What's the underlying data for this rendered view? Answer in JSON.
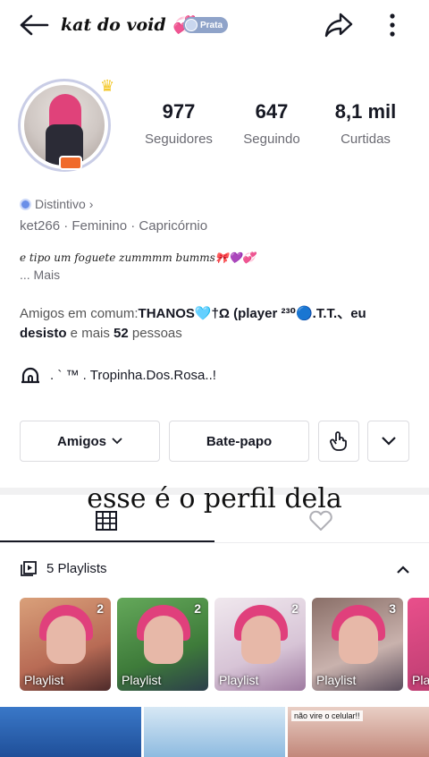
{
  "header": {
    "title": "kat do void 💞",
    "badge": "Prata"
  },
  "stats": [
    {
      "value": "977",
      "label": "Seguidores"
    },
    {
      "value": "647",
      "label": "Seguindo"
    },
    {
      "value": "8,1 mil",
      "label": "Curtidas"
    }
  ],
  "profile": {
    "distintivo": "Distintivo",
    "meta": "ket266 · Feminino · Capricórnio",
    "bio": "e tipo um foguete zummmm bumms🎀💜💞",
    "bio_more": "... Mais"
  },
  "mutual": {
    "prefix": "Amigos em comum:",
    "names": "THANOS🩵†Ω (player ²³⁰🔵.T.T.、eu desisto",
    "middle": " e mais ",
    "count": "52",
    "suffix": " pessoas"
  },
  "group": {
    "label": ". ` ™ . Tropinha.Dos.Rosa..!"
  },
  "actions": {
    "friends": "Amigos",
    "chat": "Bate-papo"
  },
  "caption": "esse é o perfil dela",
  "playlists": {
    "header": "5 Playlists",
    "items": [
      {
        "label": "Playlist",
        "count": "2"
      },
      {
        "label": "Playlist",
        "count": "2"
      },
      {
        "label": "Playlist",
        "count": "2"
      },
      {
        "label": "Playlist",
        "count": "3"
      },
      {
        "label": "Pla",
        "count": ""
      }
    ]
  },
  "grid": {
    "note": "não vire o celular!!"
  }
}
